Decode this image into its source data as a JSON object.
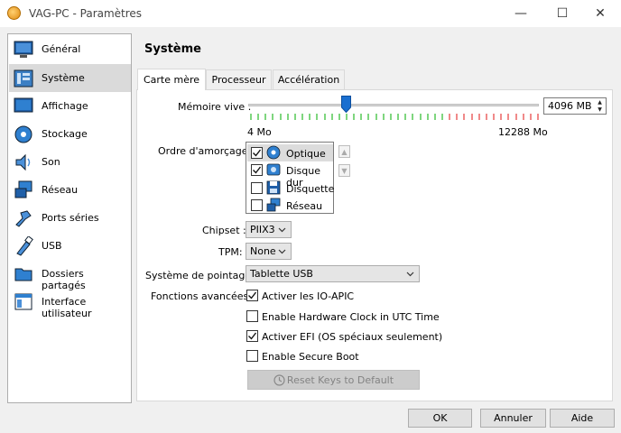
{
  "window": {
    "title": "VAG-PC - Paramètres",
    "minimize_glyph": "—",
    "maximize_glyph": "☐",
    "close_glyph": "✕"
  },
  "sidebar": {
    "items": [
      {
        "label": "Général",
        "icon": "general-icon"
      },
      {
        "label": "Système",
        "icon": "system-icon",
        "selected": true
      },
      {
        "label": "Affichage",
        "icon": "display-icon"
      },
      {
        "label": "Stockage",
        "icon": "storage-icon"
      },
      {
        "label": "Son",
        "icon": "sound-icon"
      },
      {
        "label": "Réseau",
        "icon": "network-icon"
      },
      {
        "label": "Ports séries",
        "icon": "serial-ports-icon"
      },
      {
        "label": "USB",
        "icon": "usb-icon"
      },
      {
        "label": "Dossiers partagés",
        "icon": "shared-folders-icon"
      },
      {
        "label": "Interface utilisateur",
        "icon": "user-interface-icon"
      }
    ]
  },
  "section_title": "Système",
  "tabs": [
    {
      "label": "Carte mère",
      "active": true
    },
    {
      "label": "Processeur"
    },
    {
      "label": "Accélération"
    }
  ],
  "memory": {
    "label": "Mémoire vive :",
    "value": "4096 MB",
    "min_label": "4 Mo",
    "max_label": "12288 Mo",
    "value_mb": 4096,
    "min_mb": 4,
    "max_mb": 12288
  },
  "boot_order": {
    "label": "Ordre d'amorçage :",
    "items": [
      {
        "label": "Optique",
        "checked": true,
        "icon": "optical-disc-icon",
        "selected": true
      },
      {
        "label": "Disque dur",
        "checked": true,
        "icon": "hard-disk-icon"
      },
      {
        "label": "Disquette",
        "checked": false,
        "icon": "floppy-icon"
      },
      {
        "label": "Réseau",
        "checked": false,
        "icon": "network-boot-icon"
      }
    ],
    "up_glyph": "▲",
    "down_glyph": "▼"
  },
  "chipset": {
    "label": "Chipset :",
    "value": "PIIX3"
  },
  "tpm": {
    "label": "TPM:",
    "value": "None"
  },
  "pointing": {
    "label": "Système de pointage :",
    "value": "Tablette USB"
  },
  "features": {
    "label": "Fonctions avancées :",
    "options": [
      {
        "label": "Activer les IO-APIC",
        "checked": true
      },
      {
        "label": "Enable Hardware Clock in UTC Time",
        "checked": false
      },
      {
        "label": "Activer EFI (OS spéciaux seulement)",
        "checked": true
      },
      {
        "label": "Enable Secure Boot",
        "checked": false
      }
    ]
  },
  "reset_keys": "Reset Keys to Default",
  "buttons": {
    "ok": "OK",
    "cancel": "Annuler",
    "help": "Aide"
  },
  "colors": {
    "slider_thumb": "#1a6fd0",
    "tick_green": "#7fd67f",
    "tick_red": "#f08a8a",
    "selection": "#dadada"
  }
}
